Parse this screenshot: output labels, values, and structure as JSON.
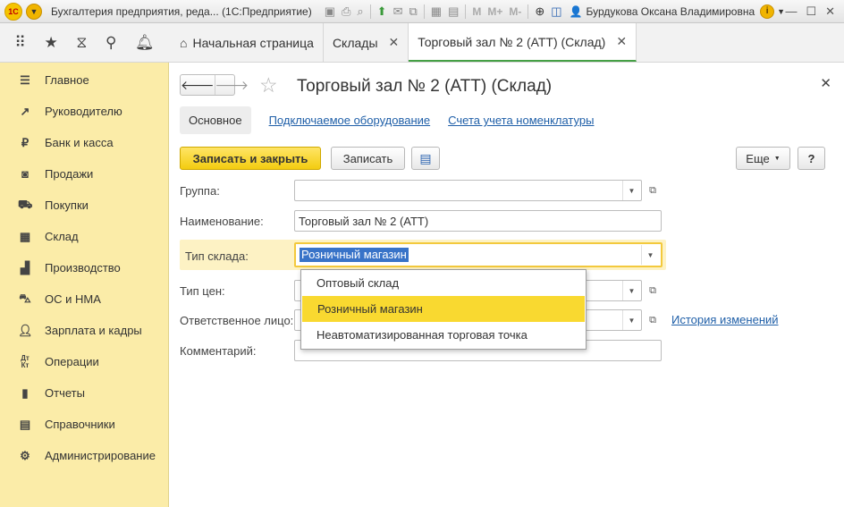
{
  "titlebar": {
    "app_title": "Бухгалтерия предприятия, реда...  (1С:Предприятие)",
    "user": "Бурдукова Оксана Владимировна",
    "logo": "1С",
    "mmm": [
      "M",
      "M+",
      "M-"
    ]
  },
  "nav": {
    "tabs": [
      {
        "label": "Начальная страница"
      },
      {
        "label": "Склады"
      },
      {
        "label": "Торговый зал № 2 (АТТ) (Склад)"
      }
    ]
  },
  "sidebar": {
    "items": [
      {
        "label": "Главное",
        "icon": "menu-icon"
      },
      {
        "label": "Руководителю",
        "icon": "trend-icon"
      },
      {
        "label": "Банк и касса",
        "icon": "ruble-icon"
      },
      {
        "label": "Продажи",
        "icon": "bag-icon"
      },
      {
        "label": "Покупки",
        "icon": "cart-icon"
      },
      {
        "label": "Склад",
        "icon": "warehouse-icon"
      },
      {
        "label": "Производство",
        "icon": "factory-icon"
      },
      {
        "label": "ОС и НМА",
        "icon": "truck-icon"
      },
      {
        "label": "Зарплата и кадры",
        "icon": "people-icon"
      },
      {
        "label": "Операции",
        "icon": "dt-kt-icon"
      },
      {
        "label": "Отчеты",
        "icon": "chart-icon"
      },
      {
        "label": "Справочники",
        "icon": "book-icon"
      },
      {
        "label": "Администрирование",
        "icon": "gear-icon"
      }
    ]
  },
  "form": {
    "title": "Торговый зал № 2 (АТТ) (Склад)",
    "tabs": {
      "main": "Основное",
      "equipment": "Подключаемое оборудование",
      "accounts": "Счета учета номенклатуры"
    },
    "buttons": {
      "save_close": "Записать и закрыть",
      "save": "Записать",
      "more": "Еще",
      "help": "?"
    },
    "fields": {
      "group_label": "Группа:",
      "group_value": "",
      "name_label": "Наименование:",
      "name_value": "Торговый зал № 2 (АТТ)",
      "type_label": "Тип склада:",
      "type_value": "Розничный магазин",
      "price_label": "Тип цен:",
      "responsible_label": "Ответственное лицо:",
      "comment_label": "Комментарий:",
      "history_link": "История изменений"
    },
    "dropdown_options": [
      "Оптовый склад",
      "Розничный магазин",
      "Неавтоматизированная торговая точка"
    ]
  },
  "colors": {
    "sidebar_bg": "#fbeca8",
    "primary_button": "#f3cc10",
    "selected_option": "#f9d930",
    "link": "#1f5fa8",
    "active_tab_underline": "#45a045"
  }
}
